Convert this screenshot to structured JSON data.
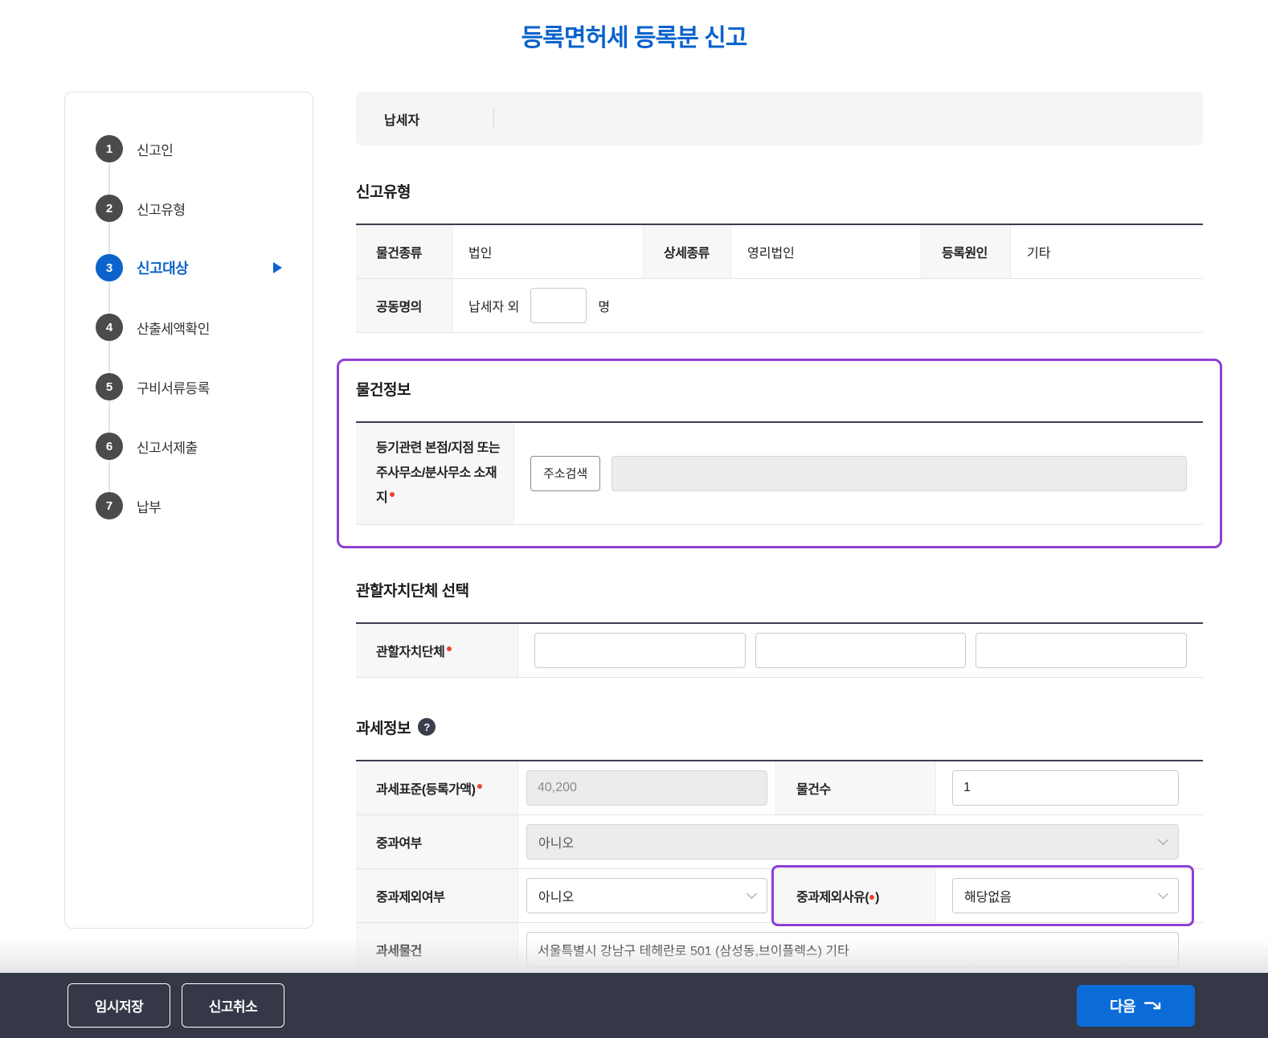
{
  "page_title": "등록면허세 등록분 신고",
  "colors": {
    "accent_blue": "#0b63cc",
    "highlight_purple": "#8e3fd4",
    "footer_bg": "#343847",
    "next_button_blue": "#0b6cd8",
    "label_cell_bg": "#f7f7f7"
  },
  "stepper": {
    "active_step": "3",
    "steps": [
      {
        "num": "1",
        "label": "신고인"
      },
      {
        "num": "2",
        "label": "신고유형"
      },
      {
        "num": "3",
        "label": "신고대상"
      },
      {
        "num": "4",
        "label": "산출세액확인"
      },
      {
        "num": "5",
        "label": "구비서류등록"
      },
      {
        "num": "6",
        "label": "신고서제출"
      },
      {
        "num": "7",
        "label": "납부"
      }
    ]
  },
  "taxpayer": {
    "label": "납세자",
    "value": ""
  },
  "report_type": {
    "title": "신고유형",
    "property_kind_label": "물건종류",
    "property_kind_value": "법인",
    "detail_kind_label": "상세종류",
    "detail_kind_value": "영리법인",
    "reg_cause_label": "등록원인",
    "reg_cause_value": "기타",
    "joint_label": "공동명의",
    "joint_prefix": "납세자 외",
    "joint_count_value": "",
    "joint_suffix": "명"
  },
  "property_info": {
    "title": "물건정보",
    "address_label": "등기관련 본점/지점 또는 주사무소/분사무소 소재지",
    "search_button": "주소검색",
    "address_value": ""
  },
  "district": {
    "title": "관할자치단체 선택",
    "label": "관할자치단체",
    "input1": "",
    "input2": "",
    "input3": ""
  },
  "tax_info": {
    "title": "과세정보",
    "help_icon_glyph": "?",
    "base_label": "과세표준(등록가액)",
    "base_value": "40,200",
    "count_label": "물건수",
    "count_value": "1",
    "heavy_label": "중과여부",
    "heavy_value": "아니오",
    "heavy_excl_label": "중과제외여부",
    "heavy_excl_value": "아니오",
    "excl_reason_label_prefix": "중과제외사유(",
    "excl_reason_label_suffix": ")",
    "excl_reason_value": "해당없음",
    "object_label": "과세물건",
    "object_value": "서울특별시 강남구 테헤란로 501 (삼성동,브이플렉스) 기타"
  },
  "footer": {
    "temp_save_label": "임시저장",
    "cancel_label": "신고취소",
    "next_label": "다음"
  }
}
